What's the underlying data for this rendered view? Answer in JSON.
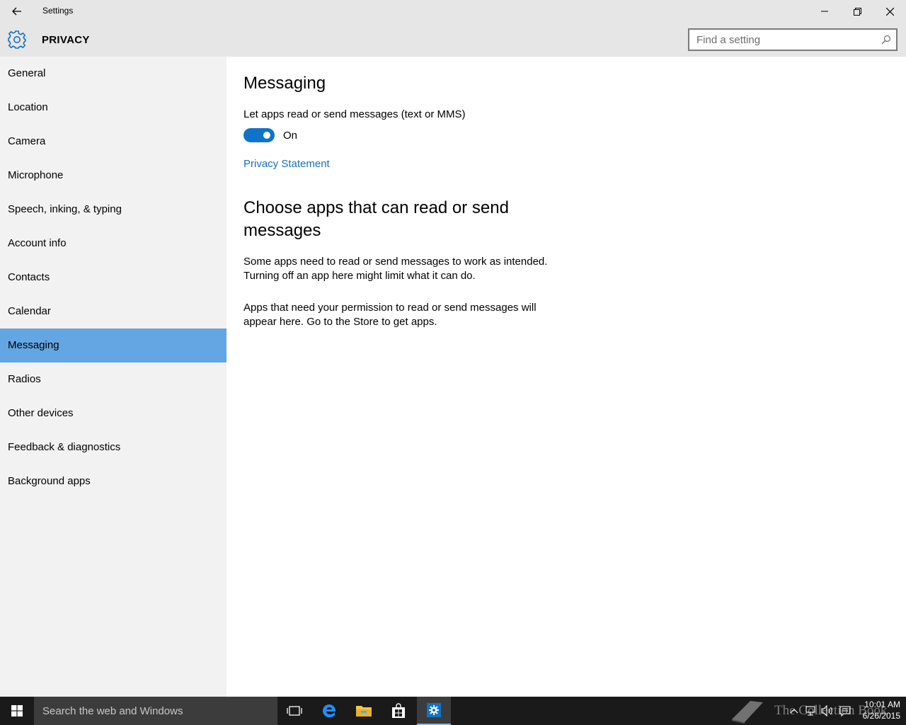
{
  "window": {
    "title": "Settings"
  },
  "header": {
    "section_title": "PRIVACY",
    "search_placeholder": "Find a setting"
  },
  "sidebar": {
    "items": [
      {
        "label": "General",
        "active": false
      },
      {
        "label": "Location",
        "active": false
      },
      {
        "label": "Camera",
        "active": false
      },
      {
        "label": "Microphone",
        "active": false
      },
      {
        "label": "Speech, inking, & typing",
        "active": false
      },
      {
        "label": "Account info",
        "active": false
      },
      {
        "label": "Contacts",
        "active": false
      },
      {
        "label": "Calendar",
        "active": false
      },
      {
        "label": "Messaging",
        "active": true
      },
      {
        "label": "Radios",
        "active": false
      },
      {
        "label": "Other devices",
        "active": false
      },
      {
        "label": "Feedback & diagnostics",
        "active": false
      },
      {
        "label": "Background apps",
        "active": false
      }
    ]
  },
  "main": {
    "heading": "Messaging",
    "setting_label": "Let apps read or send messages (text or MMS)",
    "toggle_state": "On",
    "privacy_link": "Privacy Statement",
    "sub_heading": "Choose apps that can read or send messages",
    "paragraph1": "Some apps need to read or send messages to work as intended. Turning off an app here might limit what it can do.",
    "paragraph2": "Apps that need your permission to read or send messages will appear here. Go to the Store to get apps."
  },
  "taskbar": {
    "search_placeholder": "Search the web and Windows",
    "watermark": "The Collection Book",
    "clock_time": "10:01 AM",
    "clock_date": "6/26/2015",
    "icons": [
      "windows-logo-icon",
      "task-view-icon",
      "edge-icon",
      "file-explorer-icon",
      "store-icon",
      "settings-gear-icon",
      "chevron-up-icon",
      "network-icon",
      "volume-icon",
      "action-center-icon"
    ]
  },
  "colors": {
    "accent": "#0f73c9",
    "nav_selected": "#64a6e3",
    "link": "#1a6fbf",
    "taskbar": "#1a1a1a",
    "sidebar": "#f2f2f2",
    "titlebar": "#e6e6e6"
  }
}
